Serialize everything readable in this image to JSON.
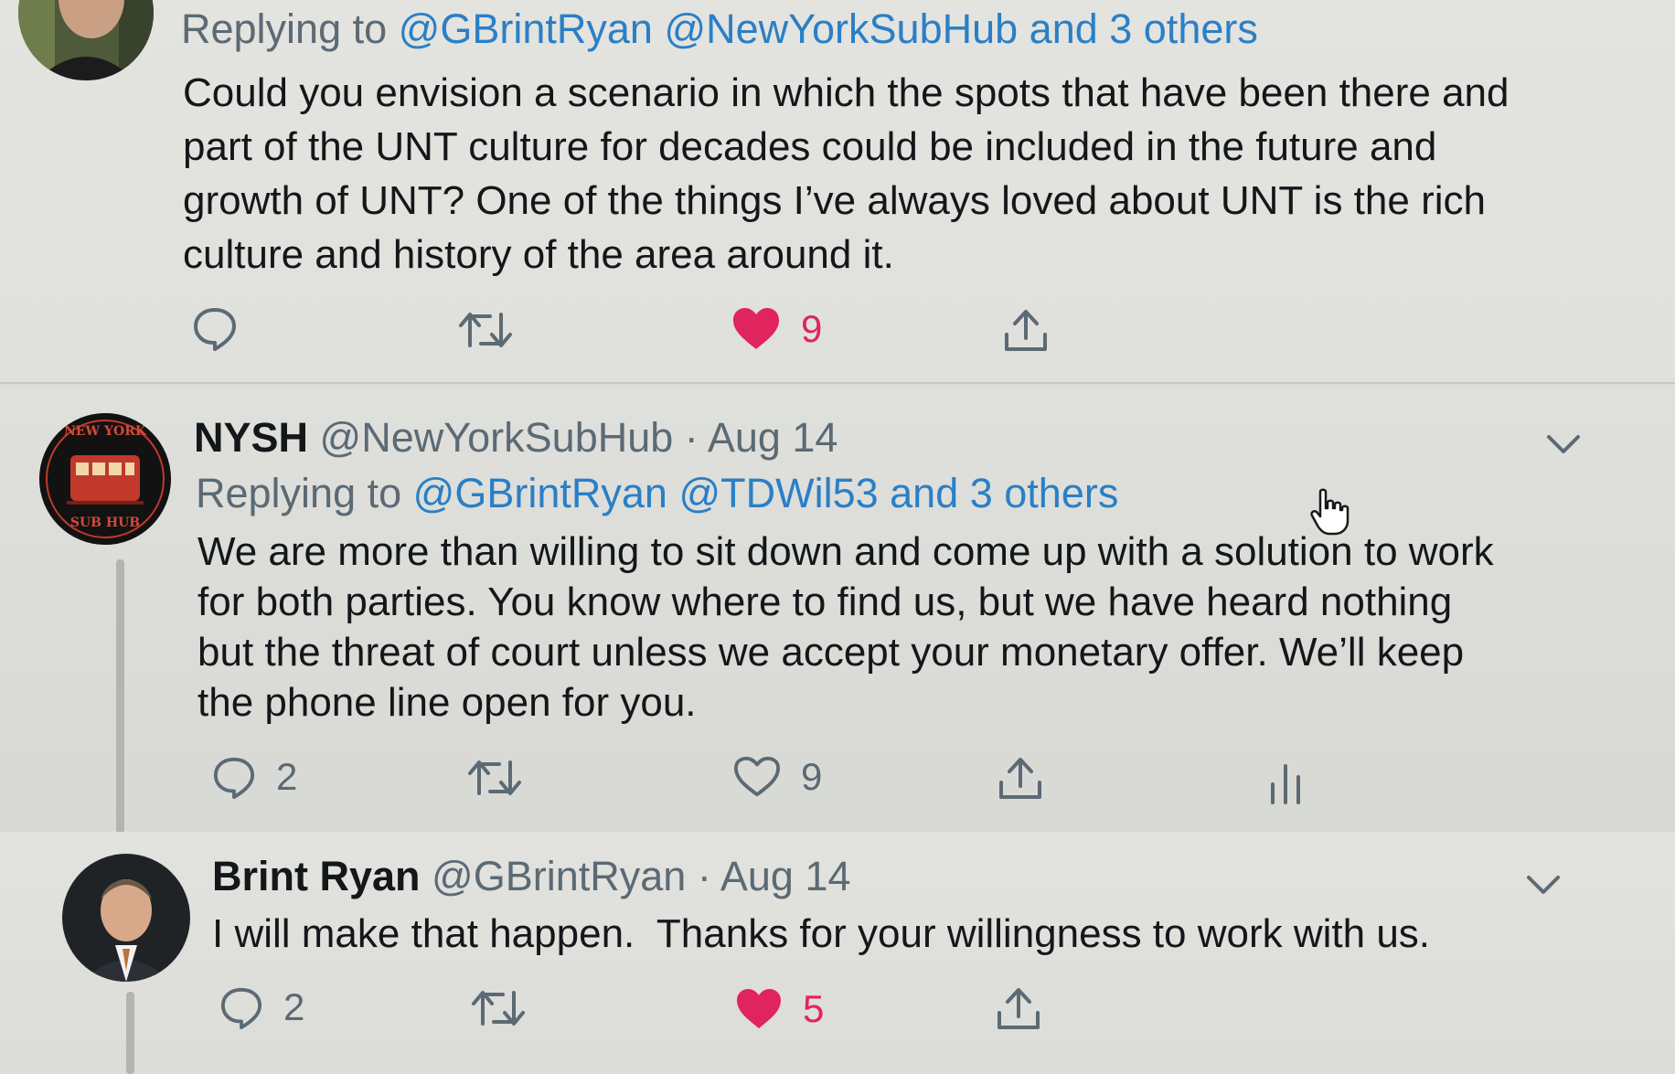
{
  "tweets": [
    {
      "replying_label": "Replying to",
      "replying_mentions": [
        "@GBrintRyan",
        "@NewYorkSubHub"
      ],
      "replying_others": "and 3 others",
      "text": "Could you envision a scenario in which the spots that have been there and\npart of the UNT culture for decades could be included in the future and\ngrowth of UNT? One of the things I’ve always loved about UNT is the rich\nculture and history of the area around it.",
      "actions": {
        "reply_icon": "comment-bubble-icon",
        "retweet_icon": "retweet-icon",
        "like_icon": "heart-filled-icon",
        "like_count": "9",
        "liked": true,
        "share_icon": "share-upload-icon"
      }
    },
    {
      "name": "NYSH",
      "handle": "@NewYorkSubHub",
      "separator": "·",
      "date": "Aug 14",
      "avatar_text_top": "NEW YORK",
      "avatar_text_bottom": "SUB HUB",
      "replying_label": "Replying to",
      "replying_mentions": [
        "@GBrintRyan",
        "@TDWil53"
      ],
      "replying_others": "and 3 others",
      "text": "We are more than willing to sit down and come up with a solution to work\nfor both parties. You know where to find us, but we have heard nothing\nbut the threat of court unless we accept your monetary offer. We’ll keep\nthe phone line open for you.",
      "actions": {
        "reply_icon": "comment-bubble-icon",
        "reply_count": "2",
        "retweet_icon": "retweet-icon",
        "like_icon": "heart-outline-icon",
        "like_count": "9",
        "liked": false,
        "share_icon": "share-upload-icon",
        "analytics_icon": "analytics-bars-icon"
      }
    },
    {
      "name": "Brint Ryan",
      "handle": "@GBrintRyan",
      "separator": "·",
      "date": "Aug 14",
      "text": "I will make that happen.  Thanks for your willingness to work with us.",
      "actions": {
        "reply_icon": "comment-bubble-icon",
        "reply_count": "2",
        "retweet_icon": "retweet-icon",
        "like_icon": "heart-filled-icon",
        "like_count": "5",
        "liked": true,
        "share_icon": "share-upload-icon"
      }
    }
  ],
  "colors": {
    "link": "#2a7fc6",
    "like": "#e0245e",
    "muted": "#5b6a74",
    "text": "#14171a"
  }
}
